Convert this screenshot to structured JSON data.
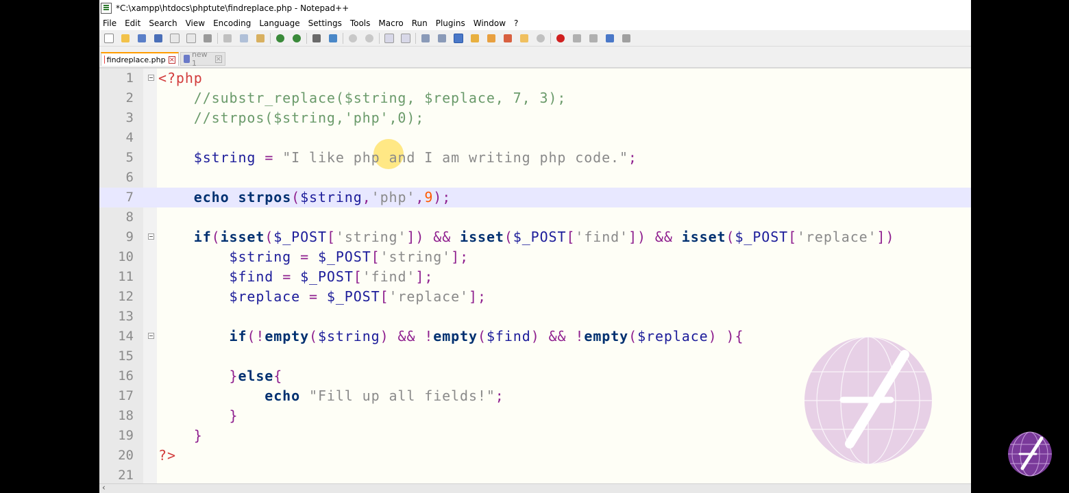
{
  "window": {
    "title": "*C:\\xampp\\htdocs\\phptute\\findreplace.php - Notepad++"
  },
  "menu": [
    "File",
    "Edit",
    "Search",
    "View",
    "Encoding",
    "Language",
    "Settings",
    "Tools",
    "Macro",
    "Run",
    "Plugins",
    "Window",
    "?"
  ],
  "tabs": [
    {
      "label": "findreplace.php",
      "active": true
    },
    {
      "label": "new 1",
      "active": false
    }
  ],
  "colors": {
    "tag": "#d23c3c",
    "comment": "#6a9a6a",
    "variable": "#1c1c9a",
    "string": "#8a8a8a",
    "keyword": "#003070",
    "number": "#ff5a00",
    "current_line": "#e8e8ff"
  },
  "editor": {
    "current_line": 7,
    "lines": [
      {
        "n": "1",
        "text": "<?php"
      },
      {
        "n": "2",
        "text": "    //substr_replace($string, $replace, 7, 3);"
      },
      {
        "n": "3",
        "text": "    //strpos($string,'php',0);"
      },
      {
        "n": "4",
        "text": ""
      },
      {
        "n": "5",
        "text": "    $string = \"I like php and I am writing php code.\";"
      },
      {
        "n": "6",
        "text": ""
      },
      {
        "n": "7",
        "text": "    echo strpos($string,'php',9);"
      },
      {
        "n": "8",
        "text": ""
      },
      {
        "n": "9",
        "text": "    if(isset($_POST['string']) && isset($_POST['find']) && isset($_POST['replace'])"
      },
      {
        "n": "10",
        "text": "        $string = $_POST['string'];"
      },
      {
        "n": "11",
        "text": "        $find = $_POST['find'];"
      },
      {
        "n": "12",
        "text": "        $replace = $_POST['replace'];"
      },
      {
        "n": "13",
        "text": ""
      },
      {
        "n": "14",
        "text": "        if(!empty($string) && !empty($find) && !empty($replace) ){"
      },
      {
        "n": "15",
        "text": ""
      },
      {
        "n": "16",
        "text": "        }else{"
      },
      {
        "n": "17",
        "text": "            echo \"Fill up all fields!\";"
      },
      {
        "n": "18",
        "text": "        }"
      },
      {
        "n": "19",
        "text": "    }"
      },
      {
        "n": "20",
        "text": "?>"
      },
      {
        "n": "21",
        "text": ""
      }
    ]
  }
}
